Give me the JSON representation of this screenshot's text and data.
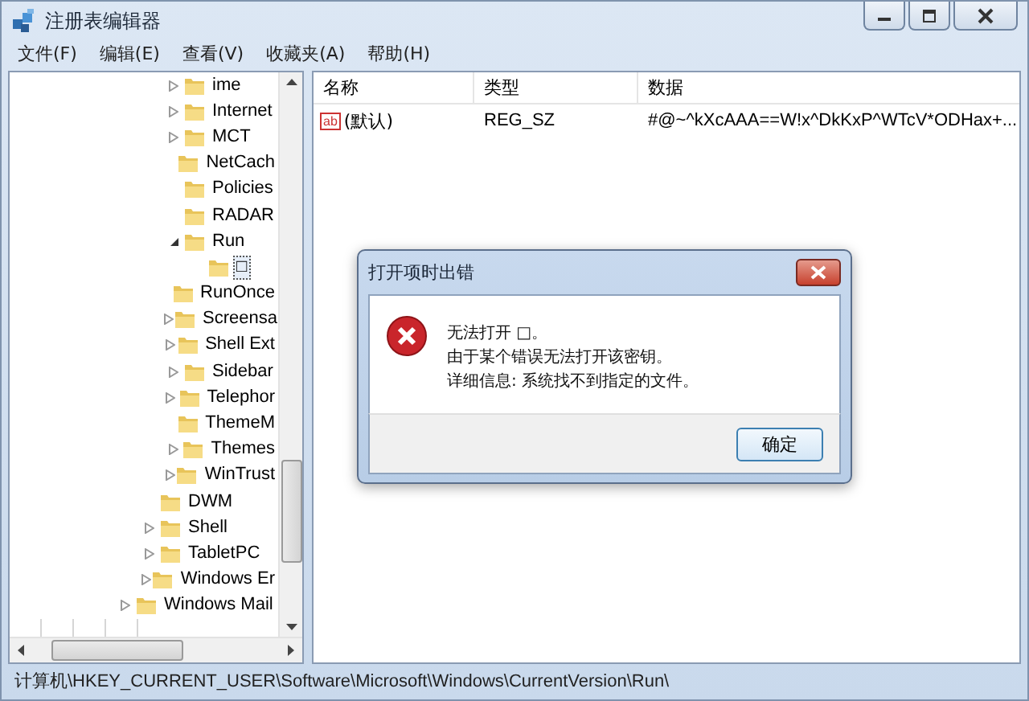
{
  "window": {
    "title": "注册表编辑器"
  },
  "menu": [
    "文件(F)",
    "编辑(E)",
    "查看(V)",
    "收藏夹(A)",
    "帮助(H)"
  ],
  "tree": {
    "items": [
      {
        "children": [
          {
            "children": [
              {
                "label": "ime",
                "expanded": false,
                "selected": false
              },
              {
                "label": "Internet",
                "expanded": false,
                "selected": false
              },
              {
                "label": "MCT",
                "expanded": false,
                "selected": false
              },
              {
                "label": "NetCach",
                "selected": false
              },
              {
                "label": "Policies",
                "selected": false
              },
              {
                "label": "RADAR",
                "selected": false
              },
              {
                "label": "Run",
                "expanded": true,
                "selected": false,
                "children": [
                  {
                    "label": "□",
                    "selected": true
                  }
                ]
              },
              {
                "label": "RunOnce",
                "selected": false
              },
              {
                "label": "Screensa",
                "expanded": false,
                "selected": false
              },
              {
                "label": "Shell Ext",
                "expanded": false,
                "selected": false
              },
              {
                "label": "Sidebar",
                "expanded": false,
                "selected": false
              },
              {
                "label": "Telephor",
                "expanded": false,
                "selected": false
              },
              {
                "label": "ThemeM",
                "selected": false
              },
              {
                "label": "Themes",
                "expanded": false,
                "selected": false
              },
              {
                "label": "WinTrust",
                "expanded": false,
                "selected": false
              }
            ]
          },
          {
            "label": "DWM",
            "selected": false
          },
          {
            "label": "Shell",
            "expanded": false,
            "selected": false
          },
          {
            "label": "TabletPC",
            "expanded": false,
            "selected": false
          },
          {
            "label": "Windows Er",
            "expanded": false,
            "selected": false
          }
        ]
      },
      {
        "label": "Windows Mail",
        "expanded": false,
        "selected": false
      }
    ]
  },
  "values": {
    "columns": [
      "名称",
      "类型",
      "数据"
    ],
    "rows": [
      {
        "icon": "ab",
        "name": "(默认)",
        "type": "REG_SZ",
        "data": "#@~^kXcAAA==W!x^DkKxP^WTcV*ODHax+..."
      }
    ]
  },
  "dialog": {
    "title": "打开项时出错",
    "lines": [
      "无法打开 □。",
      "由于某个错误无法打开该密钥。",
      "详细信息: 系统找不到指定的文件。"
    ],
    "button": "确定"
  },
  "status_bar": "计算机\\HKEY_CURRENT_USER\\Software\\Microsoft\\Windows\\CurrentVersion\\Run\\"
}
